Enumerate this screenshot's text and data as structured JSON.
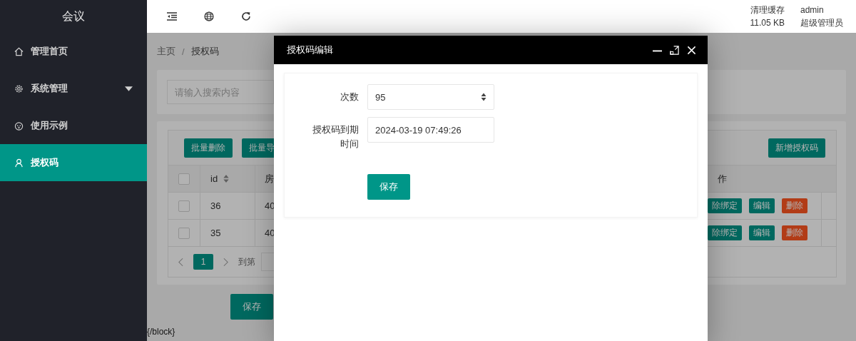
{
  "sidebar": {
    "title": "会议",
    "items": [
      {
        "label": "管理首页",
        "kind": "home",
        "selected": false,
        "has_submenu": false
      },
      {
        "label": "系统管理",
        "kind": "gear",
        "selected": false,
        "has_submenu": true
      },
      {
        "label": "使用示例",
        "kind": "face",
        "selected": false,
        "has_submenu": false
      },
      {
        "label": "授权码",
        "kind": "user",
        "selected": true,
        "has_submenu": false
      }
    ]
  },
  "header": {
    "cache": {
      "label": "清理缓存",
      "size": "11.05 KB"
    },
    "user": {
      "name": "admin",
      "role": "超级管理员"
    }
  },
  "breadcrumb": {
    "items": [
      "主页",
      "授权码"
    ],
    "separator": "/"
  },
  "search": {
    "placeholder": "请输入搜索内容"
  },
  "toolbar": {
    "left_buttons": [
      "批量删除",
      "批量导"
    ],
    "right_button": "新增授权码"
  },
  "table": {
    "header_checked": false,
    "columns": [
      {
        "kind": "checkbox"
      },
      {
        "kind": "text",
        "label": "id",
        "sortable": true
      },
      {
        "kind": "text",
        "label": "房"
      },
      {
        "kind": "text",
        "label": "作"
      }
    ],
    "rows": [
      {
        "checked": false,
        "id": "36",
        "column_3": "40",
        "actions": [
          {
            "label": "除绑定",
            "kind": "primary"
          },
          {
            "label": "编辑",
            "kind": "primary"
          },
          {
            "label": "删除",
            "kind": "danger"
          }
        ]
      },
      {
        "checked": false,
        "id": "35",
        "column_3": "40",
        "actions": [
          {
            "label": "除绑定",
            "kind": "primary"
          },
          {
            "label": "编辑",
            "kind": "primary"
          },
          {
            "label": "删除",
            "kind": "danger"
          }
        ]
      }
    ]
  },
  "pager": {
    "pages": [
      {
        "label": "1",
        "selected": true
      }
    ],
    "goto_label": "到第"
  },
  "save_button": "保存",
  "footer_text": "{/block}",
  "dialog": {
    "title": "授权码编辑",
    "fields": [
      {
        "kind": "number",
        "label": "次数",
        "value": "95"
      },
      {
        "kind": "text",
        "label": "授权码到期时间",
        "value": "2024-03-19 07:49:26"
      }
    ],
    "submit": "保存"
  }
}
